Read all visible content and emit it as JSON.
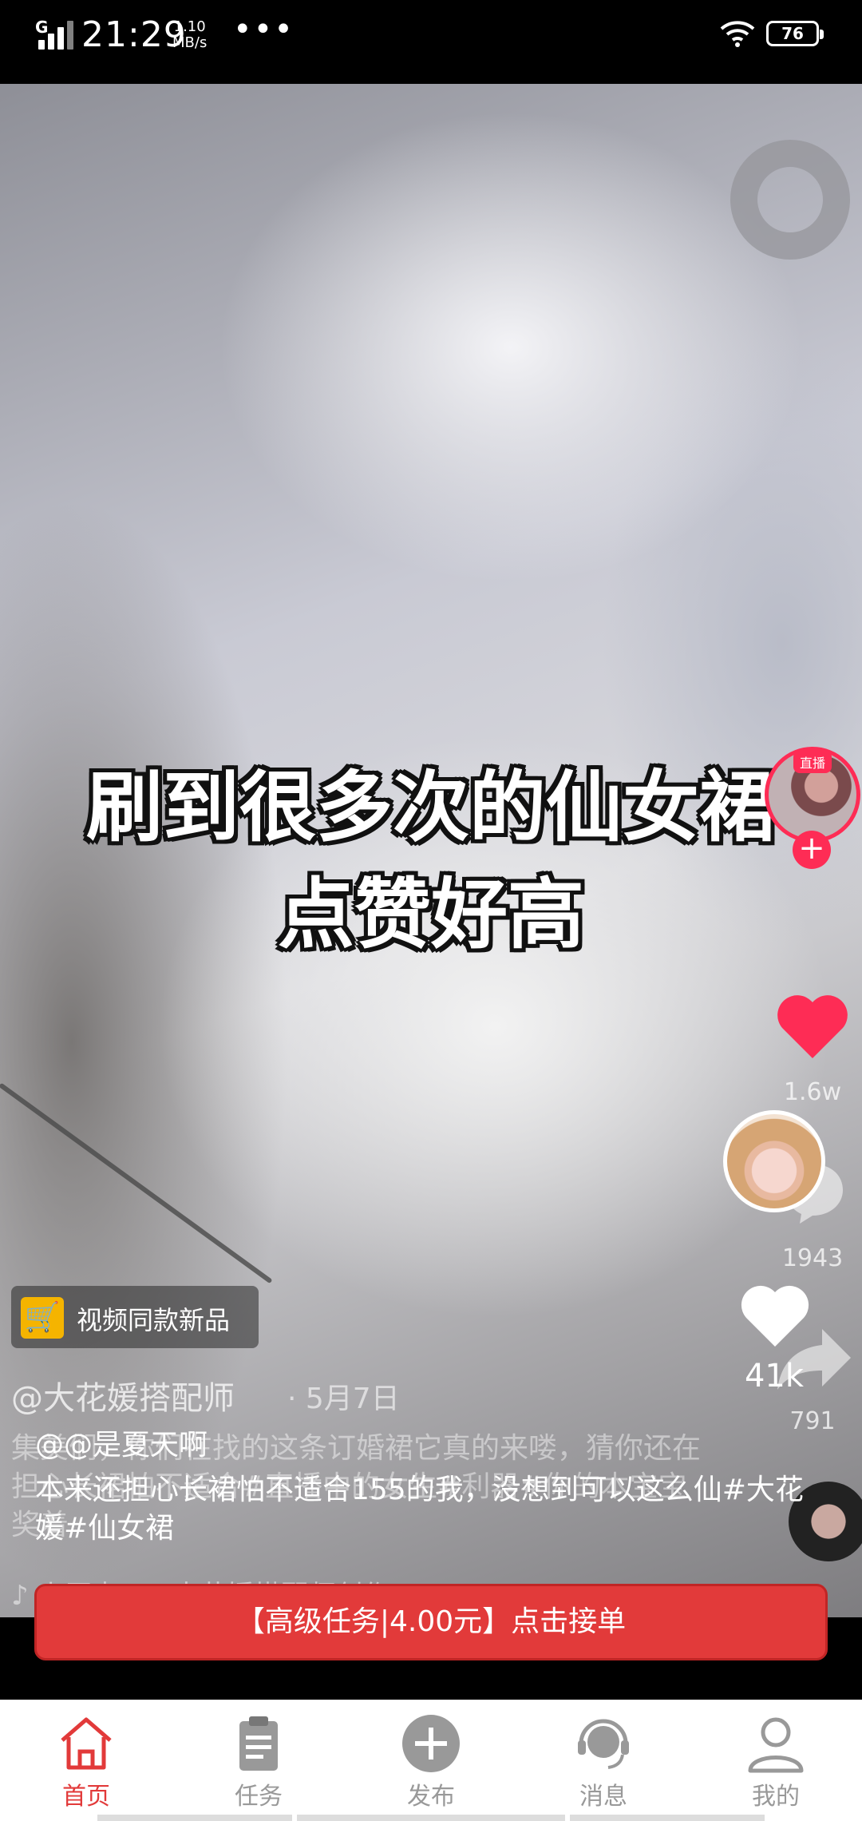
{
  "status_bar": {
    "network": "G",
    "time": "21:29",
    "speed_value": "1.10",
    "speed_unit": "MB/s",
    "dots": "•••",
    "battery": "76"
  },
  "video": {
    "overlay_line1": "刷到很多次的仙女裙",
    "overlay_line2": "点赞好高",
    "live_tag": "直播",
    "like_count_faded": "1.6w",
    "comment_count_faded": "1943",
    "share_count_faded": "791",
    "product_tag": "视频同款新品",
    "author": "@大花媛搭配师",
    "date": "· 5月7日",
    "description": "集美们，你们在找的这条订婚裙它真的来喽，猜你还在担心长裙怕不适合#直播中的女生#利器#你的本宝宝奖着",
    "music": "♪ 小原声 - @大花媛搭配师创作"
  },
  "overlay": {
    "username": "@@是夏天啊",
    "description": "本来还担心长裙怕不适合155的我，没想到可以这么仙#大花媛#仙女裙",
    "like_count": "41k"
  },
  "task_button": {
    "label": "【高级任务|4.00元】点击接单"
  },
  "bottom_nav": {
    "items": [
      {
        "label": "首页",
        "icon": "home-icon",
        "active": true
      },
      {
        "label": "任务",
        "icon": "clipboard-icon",
        "active": false
      },
      {
        "label": "发布",
        "icon": "plus-circle-icon",
        "active": false
      },
      {
        "label": "消息",
        "icon": "headset-icon",
        "active": false
      },
      {
        "label": "我的",
        "icon": "user-icon",
        "active": false
      }
    ]
  },
  "colors": {
    "accent_red": "#e23a3a",
    "like_red": "#fe2c55",
    "nav_inactive": "#999999"
  }
}
